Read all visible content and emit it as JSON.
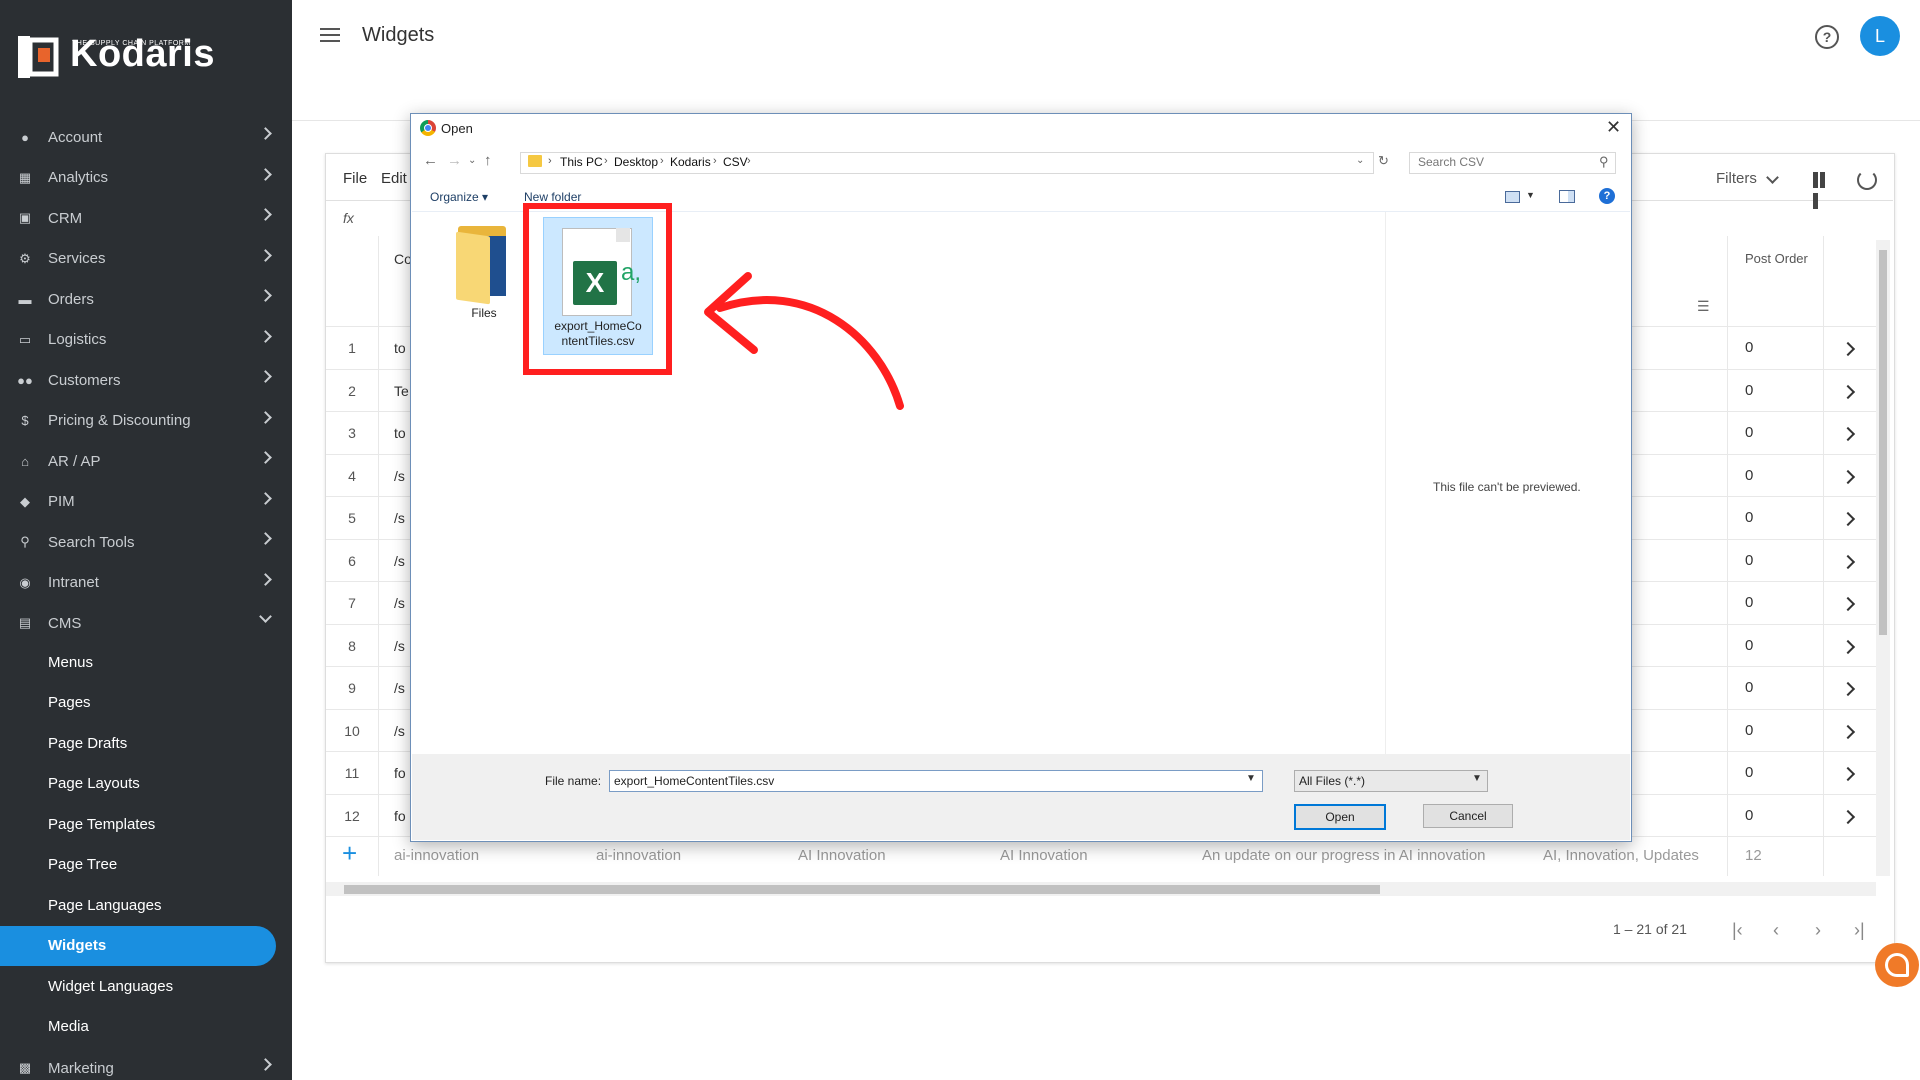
{
  "brand": {
    "name": "Kodaris",
    "tagline": "THE SUPPLY CHAIN PLATFORM"
  },
  "header": {
    "title": "Widgets",
    "avatar_letter": "L",
    "help_glyph": "?"
  },
  "sidebar": {
    "items": [
      {
        "label": "Account",
        "icon": "user-icon"
      },
      {
        "label": "Analytics",
        "icon": "chart-icon"
      },
      {
        "label": "CRM",
        "icon": "crm-icon"
      },
      {
        "label": "Services",
        "icon": "services-icon"
      },
      {
        "label": "Orders",
        "icon": "truck-icon"
      },
      {
        "label": "Logistics",
        "icon": "logistics-icon"
      },
      {
        "label": "Customers",
        "icon": "people-icon"
      },
      {
        "label": "Pricing & Discounting",
        "icon": "dollar-icon"
      },
      {
        "label": "AR / AP",
        "icon": "bank-icon"
      },
      {
        "label": "PIM",
        "icon": "tag-icon"
      },
      {
        "label": "Search Tools",
        "icon": "search-icon"
      },
      {
        "label": "Intranet",
        "icon": "intranet-icon"
      },
      {
        "label": "CMS",
        "icon": "cms-icon"
      }
    ],
    "cms_children": [
      "Menus",
      "Pages",
      "Page Drafts",
      "Page Layouts",
      "Page Templates",
      "Page Tree",
      "Page Languages",
      "Widgets",
      "Widget Languages",
      "Media"
    ],
    "active": "Widgets",
    "last_item": {
      "label": "Marketing",
      "icon": "marketing-icon"
    }
  },
  "grid": {
    "menu": [
      "File",
      "Edit"
    ],
    "fx": "fx",
    "filters_label": "Filters",
    "col_partial": "Co",
    "post_order_header": "Post Order",
    "rows": [
      {
        "num": "1",
        "cell": "to",
        "post": "0"
      },
      {
        "num": "2",
        "cell": "Te",
        "post": "0"
      },
      {
        "num": "3",
        "cell": "to",
        "post": "0"
      },
      {
        "num": "4",
        "cell": "/s",
        "post": "0"
      },
      {
        "num": "5",
        "cell": "/s",
        "post": "0"
      },
      {
        "num": "6",
        "cell": "/s",
        "post": "0"
      },
      {
        "num": "7",
        "cell": "/s",
        "post": "0"
      },
      {
        "num": "8",
        "cell": "/s",
        "post": "0"
      },
      {
        "num": "9",
        "cell": "/s",
        "post": "0"
      },
      {
        "num": "10",
        "cell": "/s",
        "post": "0"
      },
      {
        "num": "11",
        "cell": "fo",
        "post": "0"
      },
      {
        "num": "12",
        "cell": "fo",
        "post": "0"
      }
    ],
    "new_row": [
      "ai-innovation",
      "ai-innovation",
      "AI Innovation",
      "AI Innovation",
      "An update on our progress in AI innovation",
      "AI, Innovation, Updates",
      "12"
    ],
    "pager_text": "1 – 21 of 21"
  },
  "dialog": {
    "title": "Open",
    "breadcrumb": [
      "This PC",
      "Desktop",
      "Kodaris",
      "CSV"
    ],
    "search_placeholder": "Search CSV",
    "organize_label": "Organize ▾",
    "new_folder_label": "New folder",
    "files": [
      {
        "name": "Files",
        "type": "folder"
      },
      {
        "name": "export_HomeContentTiles.csv",
        "label_line1": "export_HomeCo",
        "label_line2": "ntentTiles.csv",
        "type": "excel-csv",
        "selected": true
      }
    ],
    "preview_text": "This file can't be previewed.",
    "filename_label": "File name:",
    "filename_value": "export_HomeContentTiles.csv",
    "filetype_value": "All Files (*.*)",
    "open_label": "Open",
    "cancel_label": "Cancel"
  },
  "annotation": {
    "highlight_color": "#ff1f1f"
  },
  "colors": {
    "accent": "#1a8fe0",
    "sidebar_bg": "#2b2f33",
    "excel_green": "#217346"
  }
}
